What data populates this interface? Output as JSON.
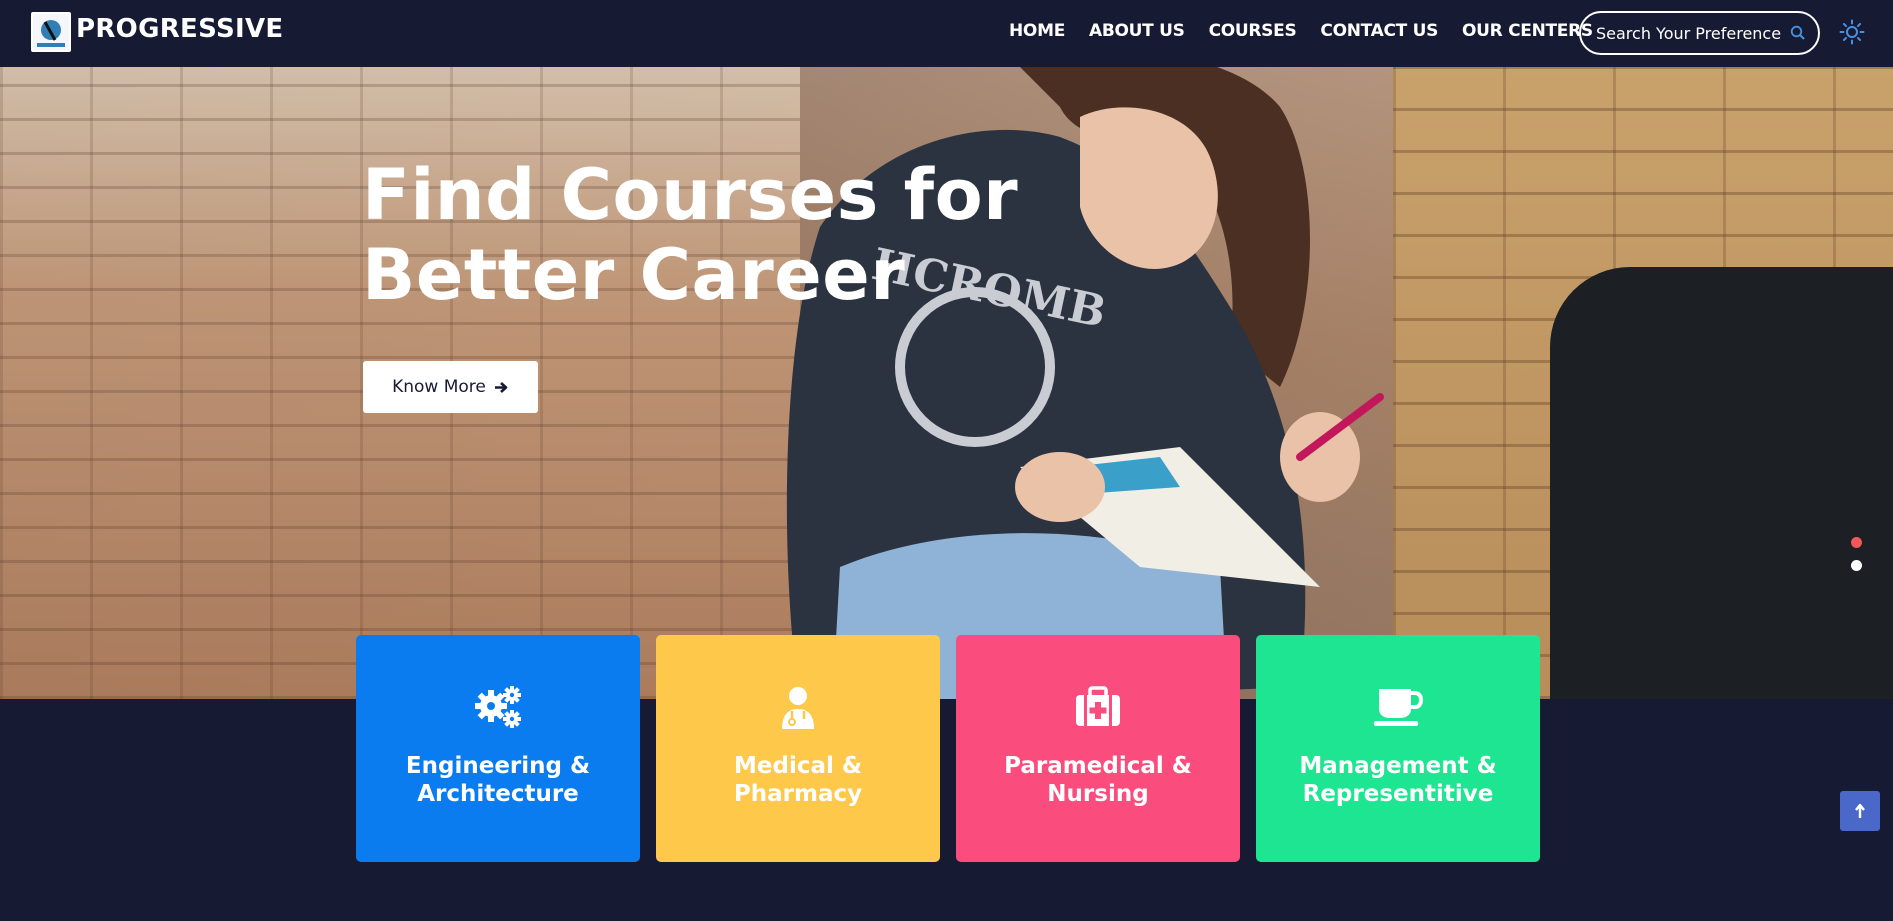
{
  "brand": {
    "name": "PROGRESSIVE",
    "logo_icon": "progressive-logo"
  },
  "nav": {
    "items": [
      {
        "label": "HOME"
      },
      {
        "label": "ABOUT US"
      },
      {
        "label": "COURSES"
      },
      {
        "label": "CONTACT US"
      },
      {
        "label": "OUR CENTERS"
      }
    ]
  },
  "search": {
    "placeholder": "Search Your Preference",
    "icon": "search-icon"
  },
  "theme_toggle": {
    "icon": "sun-icon"
  },
  "hero": {
    "title": "Find Courses for\nBetter Career",
    "cta_label": "Know More",
    "cta_icon": "arrow-right-icon",
    "slides": {
      "count": 2,
      "active_index": 0
    }
  },
  "categories": [
    {
      "label": "Engineering &\nArchitecture",
      "icon": "gears-icon",
      "color": "#0a7cf0"
    },
    {
      "label": "Medical &\nPharmacy",
      "icon": "doctor-icon",
      "color": "#fec84a"
    },
    {
      "label": "Paramedical &\nNursing",
      "icon": "medkit-icon",
      "color": "#fb4c7e"
    },
    {
      "label": "Management &\nRepresentitive",
      "icon": "coffee-cup-icon",
      "color": "#1ee591"
    }
  ],
  "back_to_top": {
    "icon": "arrow-up-icon"
  },
  "colors": {
    "background": "#161b33",
    "accent_blue": "#4a68c9",
    "dot_active": "#f2575a"
  }
}
